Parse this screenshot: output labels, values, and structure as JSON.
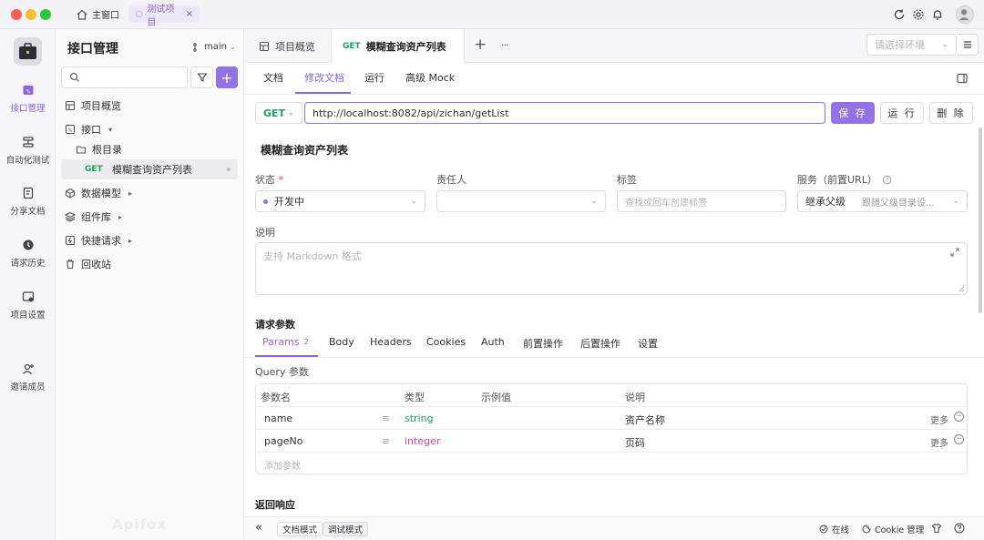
{
  "titlebar": {
    "tabs": [
      {
        "label": "主窗口",
        "icon": "home-icon"
      },
      {
        "label": "测试项目",
        "icon": "project-icon"
      }
    ],
    "close_glyph": "×"
  },
  "rail": {
    "items": [
      {
        "label": "接口管理",
        "active": true
      },
      {
        "label": "自动化测试"
      },
      {
        "label": "分享文档"
      },
      {
        "label": "请求历史"
      },
      {
        "label": "项目设置"
      },
      {
        "label": "邀请成员"
      }
    ],
    "watermark": "Apifox"
  },
  "tree": {
    "title": "接口管理",
    "branch": "main",
    "items": [
      {
        "label": "项目概览"
      },
      {
        "label": "接口"
      },
      {
        "label": "根目录"
      },
      {
        "label": "模糊查询资产列表",
        "method": "GET"
      },
      {
        "label": "数据模型"
      },
      {
        "label": "组件库"
      },
      {
        "label": "快捷请求"
      },
      {
        "label": "回收站"
      }
    ],
    "add_glyph": "+"
  },
  "main": {
    "tabs": [
      {
        "label": "项目概览"
      },
      {
        "label": "模糊查询资产列表",
        "method": "GET"
      }
    ],
    "add_tab_glyph": "+",
    "more_glyph": "···",
    "env_placeholder": "请选择环境",
    "subtabs": [
      "文档",
      "修改文档",
      "运行",
      "高级 Mock"
    ],
    "method": "GET",
    "url": "http://localhost:8082/api/zichan/getList",
    "buttons": {
      "save": "保 存",
      "run": "运 行",
      "delete": "删 除"
    },
    "name": "模糊查询资产列表",
    "fields": {
      "status_label": "状态",
      "required_mark": "*",
      "status_value": "开发中",
      "owner_label": "责任人",
      "tags_label": "标签",
      "tags_placeholder": "查找或回车创建标签",
      "service_label": "服务（前置URL）",
      "service_value": "继承父级",
      "service_hint": "跟随父级目录设...",
      "desc_label": "说明",
      "desc_placeholder": "支持 Markdown 格式"
    },
    "request": {
      "title": "请求参数",
      "tabs": [
        {
          "label": "Params",
          "count": "2"
        },
        {
          "label": "Body"
        },
        {
          "label": "Headers"
        },
        {
          "label": "Cookies"
        },
        {
          "label": "Auth"
        },
        {
          "label": "前置操作"
        },
        {
          "label": "后置操作"
        },
        {
          "label": "设置"
        }
      ],
      "query_title": "Query 参数",
      "columns": [
        "参数名",
        "类型",
        "示例值",
        "说明"
      ],
      "rows": [
        {
          "name": "name",
          "type": "string",
          "desc": "资产名称",
          "more": "更多"
        },
        {
          "name": "pageNo",
          "type": "integer",
          "desc": "页码",
          "more": "更多"
        }
      ],
      "add_placeholder": "添加参数"
    },
    "response_title": "返回响应"
  },
  "bottom": {
    "collapse_glyph": "«",
    "modes": [
      "文档模式",
      "调试模式"
    ],
    "online": "在线",
    "cookie": "Cookie 管理"
  },
  "colors": {
    "accent": "#8b66e0",
    "get": "#1aa260",
    "integer": "#d63fb0",
    "string": "#1aa260"
  }
}
